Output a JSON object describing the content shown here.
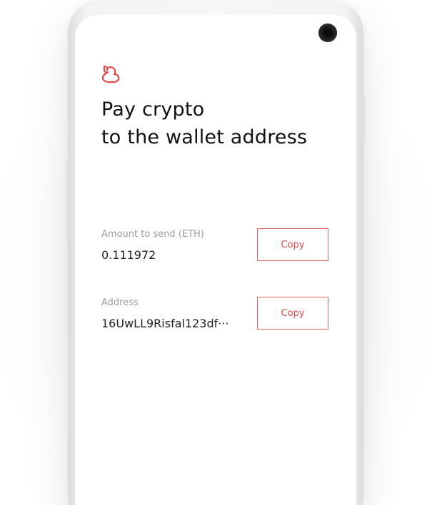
{
  "app": {
    "logo_icon": "duck-icon",
    "accent_color": "#e24848"
  },
  "header": {
    "title_line1": "Pay crypto",
    "title_line2": "to the wallet address"
  },
  "amount": {
    "label": "Amount to send (ETH)",
    "value": "0.111972",
    "copy_label": "Copy"
  },
  "address": {
    "label": "Address",
    "value": "16UwLL9Risfal123df···",
    "copy_label": "Copy"
  }
}
